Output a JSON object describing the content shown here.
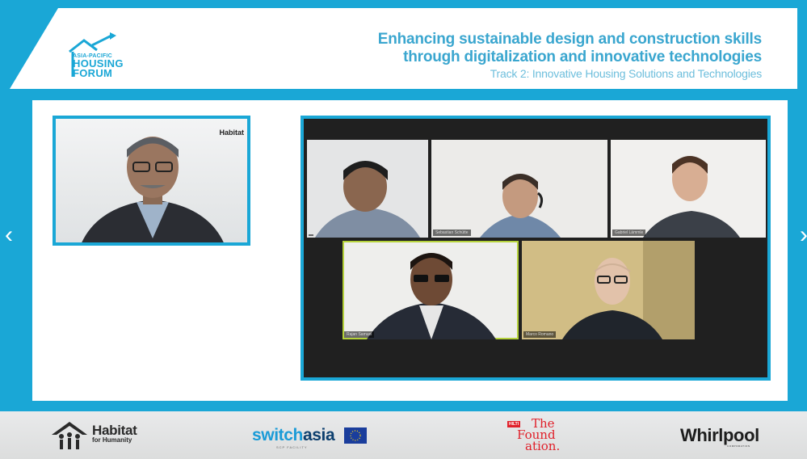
{
  "header": {
    "logo": {
      "line_small": "ASIA-PACIFIC",
      "line_main_1": "HOUSING",
      "line_main_2": "FORUM"
    },
    "title_line_1": "Enhancing sustainable design and construction skills",
    "title_line_2": "through digitalization and innovative technologies",
    "subtitle": "Track 2: Innovative Housing Solutions and Technologies"
  },
  "presenter": {
    "brand_label": "Habitat"
  },
  "gallery": {
    "tiles": [
      {
        "name": ""
      },
      {
        "name": "Sebastian Schütte"
      },
      {
        "name": "Gabriel Lämmle"
      },
      {
        "name": "Rajan Samuel"
      },
      {
        "name": "Marco Romano"
      }
    ],
    "active_tile_index": 3
  },
  "navigation": {
    "prev_glyph": "‹",
    "next_glyph": "›"
  },
  "sponsors": {
    "habitat": {
      "name": "Habitat",
      "sub": "for Humanity"
    },
    "switchasia": {
      "part1": "switch",
      "part2": "asia",
      "sub": "SCP FACILITY"
    },
    "foundation": {
      "badge": "HILTI",
      "line1": "The",
      "line2": "Found",
      "line3": "ation."
    },
    "whirlpool": {
      "name": "Whirlpool",
      "sub": "CORPORATION"
    }
  },
  "colors": {
    "frame": "#1aa7d6",
    "title": "#3aa6cf",
    "subtitle": "#6dbedc",
    "switch_blue": "#1a9bd7",
    "switch_dark": "#0d3f6e",
    "hilti_red": "#e0202a",
    "active_speaker": "#b5d23b"
  },
  "icons": {
    "logo": "house-roof-arrow-icon",
    "prev": "chevron-left-icon",
    "next": "chevron-right-icon",
    "eu_flag": "eu-flag-icon",
    "habitat_logo": "habitat-house-people-icon"
  }
}
